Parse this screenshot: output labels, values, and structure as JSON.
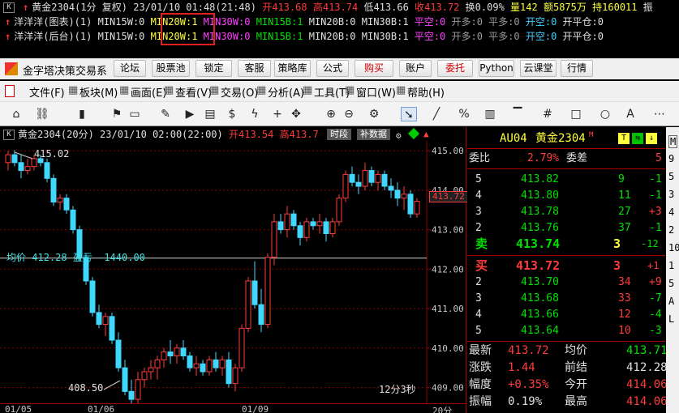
{
  "info_rows": [
    {
      "arrow": "↑",
      "prefix": "黄金2304(1分 复权) 23/01/10 01:48(21:48)",
      "open_label": "开",
      "open": "413.68",
      "high_label": "高",
      "high": "413.74",
      "low_label": "低",
      "low": "413.66",
      "close_label": "收",
      "close": "413.72",
      "chg_label": "换",
      "chg": "0.09%",
      "vol_label": "量",
      "vol": "142",
      "amt_label": "额",
      "amt": "5875万",
      "hold_label": "持",
      "hold": "160011",
      "more": "振"
    },
    {
      "arrow": "↑",
      "prefix": "洋洋洋(图表)(1)",
      "ind1": "MIN15W:0",
      "ind2": "MIN20W:1",
      "ind3": "MIN30W:0",
      "ind4": "MIN15B:1",
      "ind5": "MIN20B:0",
      "ind6": "MIN30B:1",
      "s1": "平空:0",
      "s2": "开多:0",
      "s3": "平多:0",
      "s4": "开空:0",
      "s5": "开平仓:0"
    },
    {
      "arrow": "↑",
      "prefix": "洋洋洋(后台)(1)",
      "ind1": "MIN15W:0",
      "ind2": "MIN20W:1",
      "ind3": "MIN30W:0",
      "ind4": "MIN15B:1",
      "ind5": "MIN20B:0",
      "ind6": "MIN30B:1",
      "s1": "平空:0",
      "s2": "开多:0",
      "s3": "平多:0",
      "s4": "开空:0",
      "s5": "开平仓:0"
    }
  ],
  "window": {
    "title": "金字塔决策交易系"
  },
  "toolbar_buttons": [
    "论坛",
    "股票池",
    "锁定",
    "客服",
    "策略库",
    "公式",
    "购买",
    "账户",
    "委托",
    "Python",
    "云课堂",
    "行情"
  ],
  "menu": [
    "文件(F)",
    "板块(M)",
    "画面(E)",
    "查看(V)",
    "交易(O)",
    "分析(A)",
    "工具(T)",
    "窗口(W)",
    "帮助(H)"
  ],
  "tool_icons": [
    "home-icon",
    "link-icon",
    "bar-chart-icon",
    "flag-icon",
    "monitor-icon",
    "edit-icon",
    "play-icon",
    "document-icon",
    "dollar-icon",
    "flash-icon",
    "add-icon",
    "move-icon",
    "zoom-in-icon",
    "zoom-out-icon",
    "gear-icon",
    "pointer-icon",
    "line-tool-icon",
    "percent-icon",
    "grid-icon",
    "level-icon",
    "hash-icon",
    "rect-icon",
    "circle-icon",
    "text-icon",
    "more-icon"
  ],
  "chart": {
    "header_prefix": "黄金2304(20分) 23/01/10 02:00(22:00)",
    "open_label": "开",
    "open": "413.54",
    "high_label": "高",
    "high": "413.7",
    "tab1": "时段",
    "tab2": "补数据",
    "avg_label": "均价",
    "avg_value": "412.28",
    "pl_label": "盈亏",
    "pl_value": "-1440.00",
    "hi_annot": "415.02",
    "lo_annot": "408.50",
    "timer": "12分3秒",
    "current_price": "413.72",
    "time_labels": [
      "01/05",
      "01/06",
      "01/09",
      "20分"
    ]
  },
  "chart_data": {
    "type": "candlestick",
    "y_ticks": [
      409.0,
      410.0,
      411.0,
      412.0,
      413.0,
      414.0,
      415.0
    ],
    "ylim": [
      408.6,
      415.25
    ],
    "avg_line": 412.28,
    "candles": [
      [
        414.7,
        415.0,
        414.5,
        414.9
      ],
      [
        414.9,
        415.02,
        414.6,
        414.7
      ],
      [
        414.7,
        414.9,
        414.3,
        414.5
      ],
      [
        414.5,
        414.8,
        414.4,
        414.6
      ],
      [
        414.6,
        414.9,
        414.5,
        414.8
      ],
      [
        414.8,
        414.9,
        414.6,
        414.7
      ],
      [
        414.7,
        414.8,
        414.2,
        414.3
      ],
      [
        414.3,
        414.4,
        413.6,
        413.7
      ],
      [
        413.7,
        413.9,
        413.5,
        413.8
      ],
      [
        413.8,
        413.9,
        413.4,
        413.5
      ],
      [
        413.5,
        413.6,
        412.9,
        413.0
      ],
      [
        413.0,
        413.1,
        412.2,
        412.3
      ],
      [
        412.3,
        412.4,
        411.6,
        411.7
      ],
      [
        411.7,
        411.8,
        410.8,
        410.9
      ],
      [
        410.9,
        411.1,
        410.5,
        410.6
      ],
      [
        410.6,
        410.9,
        410.3,
        410.8
      ],
      [
        410.8,
        410.9,
        410.1,
        410.2
      ],
      [
        410.2,
        410.4,
        409.4,
        409.5
      ],
      [
        409.5,
        409.7,
        408.8,
        408.9
      ],
      [
        408.9,
        409.2,
        408.5,
        408.7
      ],
      [
        408.7,
        409.4,
        408.6,
        409.2
      ],
      [
        409.2,
        409.5,
        409.0,
        409.4
      ],
      [
        409.4,
        409.7,
        409.2,
        409.5
      ],
      [
        409.5,
        409.8,
        409.2,
        409.7
      ],
      [
        409.7,
        410.0,
        409.5,
        409.9
      ],
      [
        409.9,
        410.2,
        409.6,
        409.8
      ],
      [
        409.8,
        410.1,
        409.6,
        410.0
      ],
      [
        410.0,
        410.2,
        409.7,
        409.8
      ],
      [
        409.8,
        409.9,
        409.4,
        409.5
      ],
      [
        409.5,
        409.8,
        409.3,
        409.6
      ],
      [
        409.6,
        409.7,
        409.3,
        409.4
      ],
      [
        409.4,
        409.8,
        409.3,
        409.7
      ],
      [
        409.7,
        409.9,
        409.4,
        409.5
      ],
      [
        409.5,
        409.8,
        409.3,
        409.7
      ],
      [
        409.7,
        409.9,
        409.0,
        409.1
      ],
      [
        409.1,
        409.6,
        408.9,
        409.5
      ],
      [
        409.5,
        410.6,
        409.4,
        410.5
      ],
      [
        410.5,
        411.8,
        410.4,
        411.7
      ],
      [
        411.7,
        412.2,
        411.0,
        411.1
      ],
      [
        411.1,
        411.5,
        410.4,
        410.6
      ],
      [
        410.6,
        412.4,
        410.5,
        412.3
      ],
      [
        412.3,
        413.4,
        412.1,
        413.2
      ],
      [
        413.2,
        413.4,
        412.9,
        413.0
      ],
      [
        413.0,
        413.6,
        412.8,
        413.4
      ],
      [
        413.4,
        413.5,
        413.0,
        413.1
      ],
      [
        413.1,
        413.2,
        412.6,
        412.8
      ],
      [
        412.8,
        413.3,
        412.7,
        413.2
      ],
      [
        413.2,
        413.3,
        413.0,
        413.1
      ],
      [
        413.1,
        413.4,
        412.9,
        413.2
      ],
      [
        413.2,
        413.3,
        412.7,
        412.9
      ],
      [
        412.9,
        413.3,
        412.8,
        413.2
      ],
      [
        413.2,
        413.9,
        413.1,
        413.8
      ],
      [
        413.8,
        414.5,
        413.7,
        414.4
      ],
      [
        414.4,
        414.6,
        414.1,
        414.2
      ],
      [
        414.2,
        414.4,
        413.9,
        414.1
      ],
      [
        414.1,
        414.7,
        414.0,
        414.5
      ],
      [
        414.5,
        414.6,
        414.1,
        414.2
      ],
      [
        414.2,
        414.5,
        414.0,
        414.4
      ],
      [
        414.4,
        414.5,
        414.0,
        414.1
      ],
      [
        414.1,
        414.3,
        413.8,
        414.0
      ],
      [
        414.0,
        414.2,
        413.6,
        413.8
      ],
      [
        413.8,
        414.1,
        413.5,
        413.9
      ],
      [
        413.9,
        414.0,
        413.3,
        413.4
      ],
      [
        413.4,
        413.8,
        413.3,
        413.72
      ]
    ]
  },
  "quote": {
    "code": "AU04",
    "name": "黄金2304",
    "mark": "M",
    "wb_label": "委比",
    "wb_value": "2.79%",
    "wc_label": "委差",
    "wc_value": "5",
    "asks": [
      [
        "5",
        "413.82",
        "9",
        "-1"
      ],
      [
        "4",
        "413.80",
        "11",
        "-1"
      ],
      [
        "3",
        "413.78",
        "27",
        "+3"
      ],
      [
        "2",
        "413.76",
        "37",
        "-1"
      ]
    ],
    "sell1": [
      "卖",
      "413.74",
      "3",
      "-12"
    ],
    "buy1": [
      "买",
      "413.72",
      "3",
      "+1"
    ],
    "bids": [
      [
        "2",
        "413.70",
        "34",
        "+9"
      ],
      [
        "3",
        "413.68",
        "33",
        "-7"
      ],
      [
        "4",
        "413.66",
        "12",
        "-4"
      ],
      [
        "5",
        "413.64",
        "10",
        "-3"
      ]
    ],
    "stats": [
      [
        "最新",
        "413.72",
        "均价",
        "413.71"
      ],
      [
        "涨跌",
        "1.44",
        "前结",
        "412.28"
      ],
      [
        "幅度",
        "+0.35%",
        "今开",
        "414.06"
      ],
      [
        "振幅",
        "0.19%",
        "最高",
        "414.06"
      ]
    ],
    "side_labels": [
      "M",
      "9",
      "5",
      "3",
      "4",
      "2",
      "10",
      "1",
      "5",
      "A",
      "L"
    ]
  },
  "colors": {
    "up": "#ff3c3c",
    "down": "#40d8ff",
    "bg": "#000000",
    "grid": "#8a0000",
    "accent": "#ffff40"
  }
}
